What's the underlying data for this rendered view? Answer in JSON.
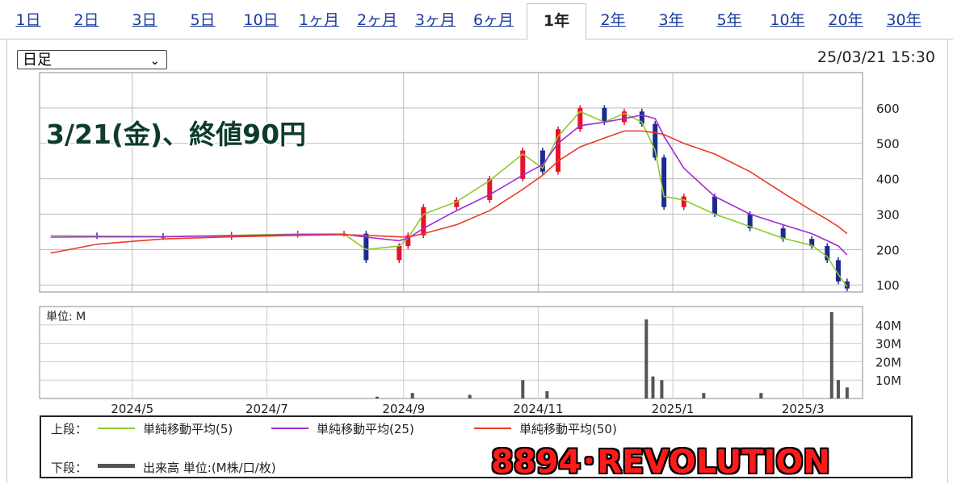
{
  "tabs": [
    "1日",
    "2日",
    "3日",
    "5日",
    "10日",
    "1ヶ月",
    "2ヶ月",
    "3ヶ月",
    "6ヶ月",
    "1年",
    "2年",
    "3年",
    "5年",
    "10年",
    "20年",
    "30年"
  ],
  "active_tab": "1年",
  "period_select": {
    "value": "日足"
  },
  "timestamp": "25/03/21 15:30",
  "annotation": "3/21(金)、終値90円",
  "brand": "8894･REVOLUTION",
  "legend": {
    "upper_label": "上段：",
    "lower_label": "下段：",
    "sma5": "単純移動平均(5)",
    "sma25": "単純移動平均(25)",
    "sma50": "単純移動平均(50)",
    "volume": "出来高 単位:(M株/口/枚)"
  },
  "colors": {
    "up": "#e8102a",
    "down": "#1c2a8f",
    "sma5": "#8ccc2a",
    "sma25": "#a12bd6",
    "sma50": "#ec3a24",
    "volume": "#555555"
  },
  "chart_data": [
    {
      "type": "line",
      "name": "price",
      "yticks": [
        100,
        200,
        300,
        400,
        500,
        600
      ],
      "ylim": [
        80,
        700
      ],
      "xticks": [
        "2024/5",
        "2024/7",
        "2024/9",
        "2024/11",
        "2025/1",
        "2025/3"
      ],
      "x": [
        "2024/3/25",
        "2024/4/15",
        "2024/5/15",
        "2024/6/15",
        "2024/7/15",
        "2024/8/5",
        "2024/8/15",
        "2024/8/30",
        "2024/9/3",
        "2024/9/10",
        "2024/9/25",
        "2024/10/10",
        "2024/10/25",
        "2024/11/3",
        "2024/11/10",
        "2024/11/20",
        "2024/12/1",
        "2024/12/10",
        "2024/12/18",
        "2024/12/24",
        "2024/12/28",
        "2025/1/6",
        "2025/1/20",
        "2025/2/5",
        "2025/2/20",
        "2025/3/5",
        "2025/3/12",
        "2025/3/17",
        "2025/3/21"
      ],
      "series": [
        {
          "name": "close",
          "values": [
            240,
            238,
            235,
            242,
            245,
            245,
            170,
            210,
            240,
            320,
            340,
            400,
            480,
            420,
            540,
            600,
            560,
            590,
            555,
            460,
            320,
            350,
            300,
            260,
            230,
            210,
            170,
            110,
            90
          ]
        },
        {
          "name": "単純移動平均(5)",
          "values": [
            240,
            238,
            237,
            240,
            244,
            244,
            200,
            210,
            232,
            300,
            335,
            395,
            470,
            430,
            520,
            590,
            560,
            585,
            560,
            480,
            350,
            340,
            300,
            265,
            232,
            212,
            180,
            130,
            95
          ]
        },
        {
          "name": "単純移動平均(25)",
          "values": [
            235,
            236,
            236,
            239,
            242,
            243,
            235,
            225,
            232,
            260,
            310,
            355,
            410,
            440,
            500,
            550,
            560,
            570,
            580,
            570,
            520,
            430,
            350,
            300,
            270,
            245,
            225,
            210,
            185
          ]
        },
        {
          "name": "単純移動平均(50)",
          "values": [
            190,
            215,
            230,
            236,
            240,
            242,
            240,
            236,
            235,
            245,
            270,
            310,
            370,
            410,
            450,
            490,
            515,
            535,
            535,
            530,
            525,
            500,
            470,
            420,
            360,
            310,
            285,
            265,
            245
          ]
        }
      ]
    },
    {
      "type": "bar",
      "name": "volume",
      "unit": "単位: M",
      "yticks": [
        "10M",
        "20M",
        "30M",
        "40M"
      ],
      "ylim": [
        0,
        50
      ],
      "x": [
        "2024/8/20",
        "2024/9/5",
        "2024/10/1",
        "2024/10/25",
        "2024/11/5",
        "2024/12/20",
        "2024/12/23",
        "2024/12/27",
        "2025/1/15",
        "2025/2/10",
        "2025/3/14",
        "2025/3/17",
        "2025/3/21"
      ],
      "values": [
        1,
        3,
        2,
        10,
        4,
        43,
        12,
        10,
        3,
        3,
        47,
        10,
        6
      ]
    }
  ]
}
